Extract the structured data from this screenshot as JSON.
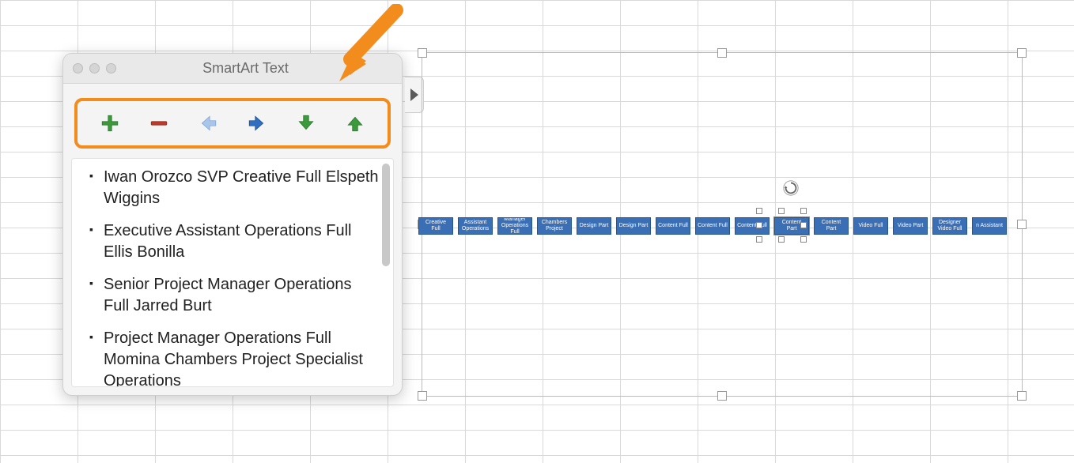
{
  "panel": {
    "title": "SmartArt Text",
    "toolbar": {
      "add": "add-shape",
      "remove": "remove-shape",
      "left": "promote-left",
      "right": "demote-right",
      "down": "move-down",
      "up": "move-up"
    },
    "items": [
      "Iwan Orozco  SVP Creative Full Elspeth Wiggins",
      "Executive Assistant Operations Full Ellis Bonilla",
      "Senior Project Manager Operations Full Jarred Burt",
      "Project Manager Operations Full Momina Chambers Project Specialist  Operations"
    ]
  },
  "annotation": {
    "arrow_color": "#f28c1c",
    "highlight_color": "#f28c1c"
  },
  "smartart": {
    "nodes": [
      "Creative Full",
      "Assistant Operations",
      "Manager Operations Full",
      "Chambers Project",
      "Design Part",
      "Design Part",
      "Content Full",
      "Content Full",
      "Content Full",
      "Content Part",
      "Content Part",
      "Video Full",
      "Video Part",
      "Designer Video Full",
      "n Assistant"
    ],
    "selected_node_index": 9
  }
}
